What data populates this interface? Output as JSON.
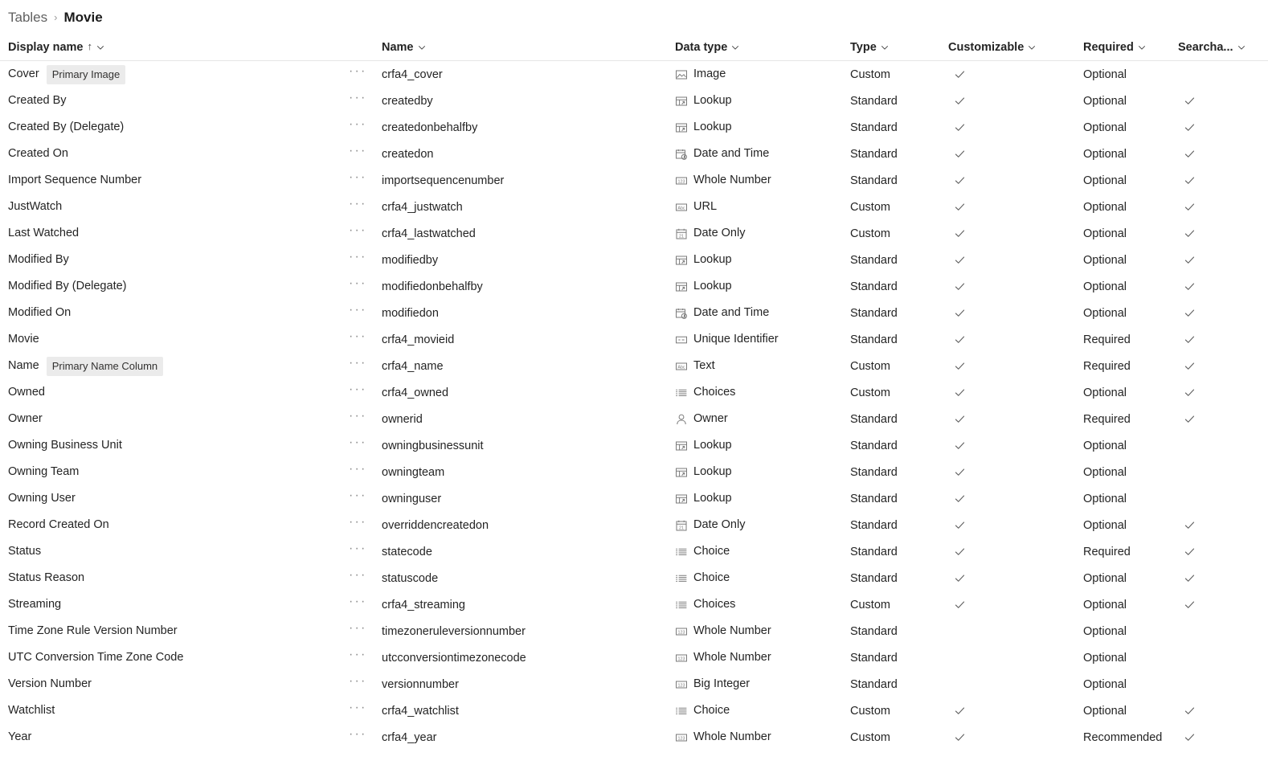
{
  "breadcrumb": {
    "parent": "Tables",
    "separator": "›",
    "current": "Movie"
  },
  "columns": [
    {
      "key": "display_name",
      "label": "Display name",
      "sorted": true,
      "sort_arrow": "↑"
    },
    {
      "key": "row_menu",
      "label": ""
    },
    {
      "key": "name",
      "label": "Name"
    },
    {
      "key": "data_type",
      "label": "Data type"
    },
    {
      "key": "type",
      "label": "Type"
    },
    {
      "key": "customizable",
      "label": "Customizable"
    },
    {
      "key": "required",
      "label": "Required"
    },
    {
      "key": "searchable",
      "label": "Searcha..."
    }
  ],
  "row_menu_glyph": "···",
  "rows": [
    {
      "display_name": "Cover",
      "badge": "Primary Image",
      "name": "crfa4_cover",
      "data_type": "Image",
      "data_type_icon": "image-icon",
      "type": "Custom",
      "customizable": true,
      "required": "Optional",
      "searchable": false
    },
    {
      "display_name": "Created By",
      "badge": "",
      "name": "createdby",
      "data_type": "Lookup",
      "data_type_icon": "lookup-icon",
      "type": "Standard",
      "customizable": true,
      "required": "Optional",
      "searchable": true
    },
    {
      "display_name": "Created By (Delegate)",
      "badge": "",
      "name": "createdonbehalfby",
      "data_type": "Lookup",
      "data_type_icon": "lookup-icon",
      "type": "Standard",
      "customizable": true,
      "required": "Optional",
      "searchable": true
    },
    {
      "display_name": "Created On",
      "badge": "",
      "name": "createdon",
      "data_type": "Date and Time",
      "data_type_icon": "date-time-icon",
      "type": "Standard",
      "customizable": true,
      "required": "Optional",
      "searchable": true
    },
    {
      "display_name": "Import Sequence Number",
      "badge": "",
      "name": "importsequencenumber",
      "data_type": "Whole Number",
      "data_type_icon": "number-icon",
      "type": "Standard",
      "customizable": true,
      "required": "Optional",
      "searchable": true
    },
    {
      "display_name": "JustWatch",
      "badge": "",
      "name": "crfa4_justwatch",
      "data_type": "URL",
      "data_type_icon": "text-icon",
      "type": "Custom",
      "customizable": true,
      "required": "Optional",
      "searchable": true
    },
    {
      "display_name": "Last Watched",
      "badge": "",
      "name": "crfa4_lastwatched",
      "data_type": "Date Only",
      "data_type_icon": "calendar-icon",
      "type": "Custom",
      "customizable": true,
      "required": "Optional",
      "searchable": true
    },
    {
      "display_name": "Modified By",
      "badge": "",
      "name": "modifiedby",
      "data_type": "Lookup",
      "data_type_icon": "lookup-icon",
      "type": "Standard",
      "customizable": true,
      "required": "Optional",
      "searchable": true
    },
    {
      "display_name": "Modified By (Delegate)",
      "badge": "",
      "name": "modifiedonbehalfby",
      "data_type": "Lookup",
      "data_type_icon": "lookup-icon",
      "type": "Standard",
      "customizable": true,
      "required": "Optional",
      "searchable": true
    },
    {
      "display_name": "Modified On",
      "badge": "",
      "name": "modifiedon",
      "data_type": "Date and Time",
      "data_type_icon": "date-time-icon",
      "type": "Standard",
      "customizable": true,
      "required": "Optional",
      "searchable": true
    },
    {
      "display_name": "Movie",
      "badge": "",
      "name": "crfa4_movieid",
      "data_type": "Unique Identifier",
      "data_type_icon": "unique-id-icon",
      "type": "Standard",
      "customizable": true,
      "required": "Required",
      "searchable": true
    },
    {
      "display_name": "Name",
      "badge": "Primary Name Column",
      "name": "crfa4_name",
      "data_type": "Text",
      "data_type_icon": "text-icon",
      "type": "Custom",
      "customizable": true,
      "required": "Required",
      "searchable": true
    },
    {
      "display_name": "Owned",
      "badge": "",
      "name": "crfa4_owned",
      "data_type": "Choices",
      "data_type_icon": "choices-icon",
      "type": "Custom",
      "customizable": true,
      "required": "Optional",
      "searchable": true
    },
    {
      "display_name": "Owner",
      "badge": "",
      "name": "ownerid",
      "data_type": "Owner",
      "data_type_icon": "person-icon",
      "type": "Standard",
      "customizable": true,
      "required": "Required",
      "searchable": true
    },
    {
      "display_name": "Owning Business Unit",
      "badge": "",
      "name": "owningbusinessunit",
      "data_type": "Lookup",
      "data_type_icon": "lookup-icon",
      "type": "Standard",
      "customizable": true,
      "required": "Optional",
      "searchable": false
    },
    {
      "display_name": "Owning Team",
      "badge": "",
      "name": "owningteam",
      "data_type": "Lookup",
      "data_type_icon": "lookup-icon",
      "type": "Standard",
      "customizable": true,
      "required": "Optional",
      "searchable": false
    },
    {
      "display_name": "Owning User",
      "badge": "",
      "name": "owninguser",
      "data_type": "Lookup",
      "data_type_icon": "lookup-icon",
      "type": "Standard",
      "customizable": true,
      "required": "Optional",
      "searchable": false
    },
    {
      "display_name": "Record Created On",
      "badge": "",
      "name": "overriddencreatedon",
      "data_type": "Date Only",
      "data_type_icon": "calendar-icon",
      "type": "Standard",
      "customizable": true,
      "required": "Optional",
      "searchable": true
    },
    {
      "display_name": "Status",
      "badge": "",
      "name": "statecode",
      "data_type": "Choice",
      "data_type_icon": "choices-icon",
      "type": "Standard",
      "customizable": true,
      "required": "Required",
      "searchable": true
    },
    {
      "display_name": "Status Reason",
      "badge": "",
      "name": "statuscode",
      "data_type": "Choice",
      "data_type_icon": "choices-icon",
      "type": "Standard",
      "customizable": true,
      "required": "Optional",
      "searchable": true
    },
    {
      "display_name": "Streaming",
      "badge": "",
      "name": "crfa4_streaming",
      "data_type": "Choices",
      "data_type_icon": "choices-icon",
      "type": "Custom",
      "customizable": true,
      "required": "Optional",
      "searchable": true
    },
    {
      "display_name": "Time Zone Rule Version Number",
      "badge": "",
      "name": "timezoneruleversionnumber",
      "data_type": "Whole Number",
      "data_type_icon": "number-icon",
      "type": "Standard",
      "customizable": false,
      "required": "Optional",
      "searchable": false
    },
    {
      "display_name": "UTC Conversion Time Zone Code",
      "badge": "",
      "name": "utcconversiontimezonecode",
      "data_type": "Whole Number",
      "data_type_icon": "number-icon",
      "type": "Standard",
      "customizable": false,
      "required": "Optional",
      "searchable": false
    },
    {
      "display_name": "Version Number",
      "badge": "",
      "name": "versionnumber",
      "data_type": "Big Integer",
      "data_type_icon": "number-icon",
      "type": "Standard",
      "customizable": false,
      "required": "Optional",
      "searchable": false
    },
    {
      "display_name": "Watchlist",
      "badge": "",
      "name": "crfa4_watchlist",
      "data_type": "Choice",
      "data_type_icon": "choices-icon",
      "type": "Custom",
      "customizable": true,
      "required": "Optional",
      "searchable": true
    },
    {
      "display_name": "Year",
      "badge": "",
      "name": "crfa4_year",
      "data_type": "Whole Number",
      "data_type_icon": "number-icon",
      "type": "Custom",
      "customizable": true,
      "required": "Recommended",
      "searchable": true
    }
  ]
}
